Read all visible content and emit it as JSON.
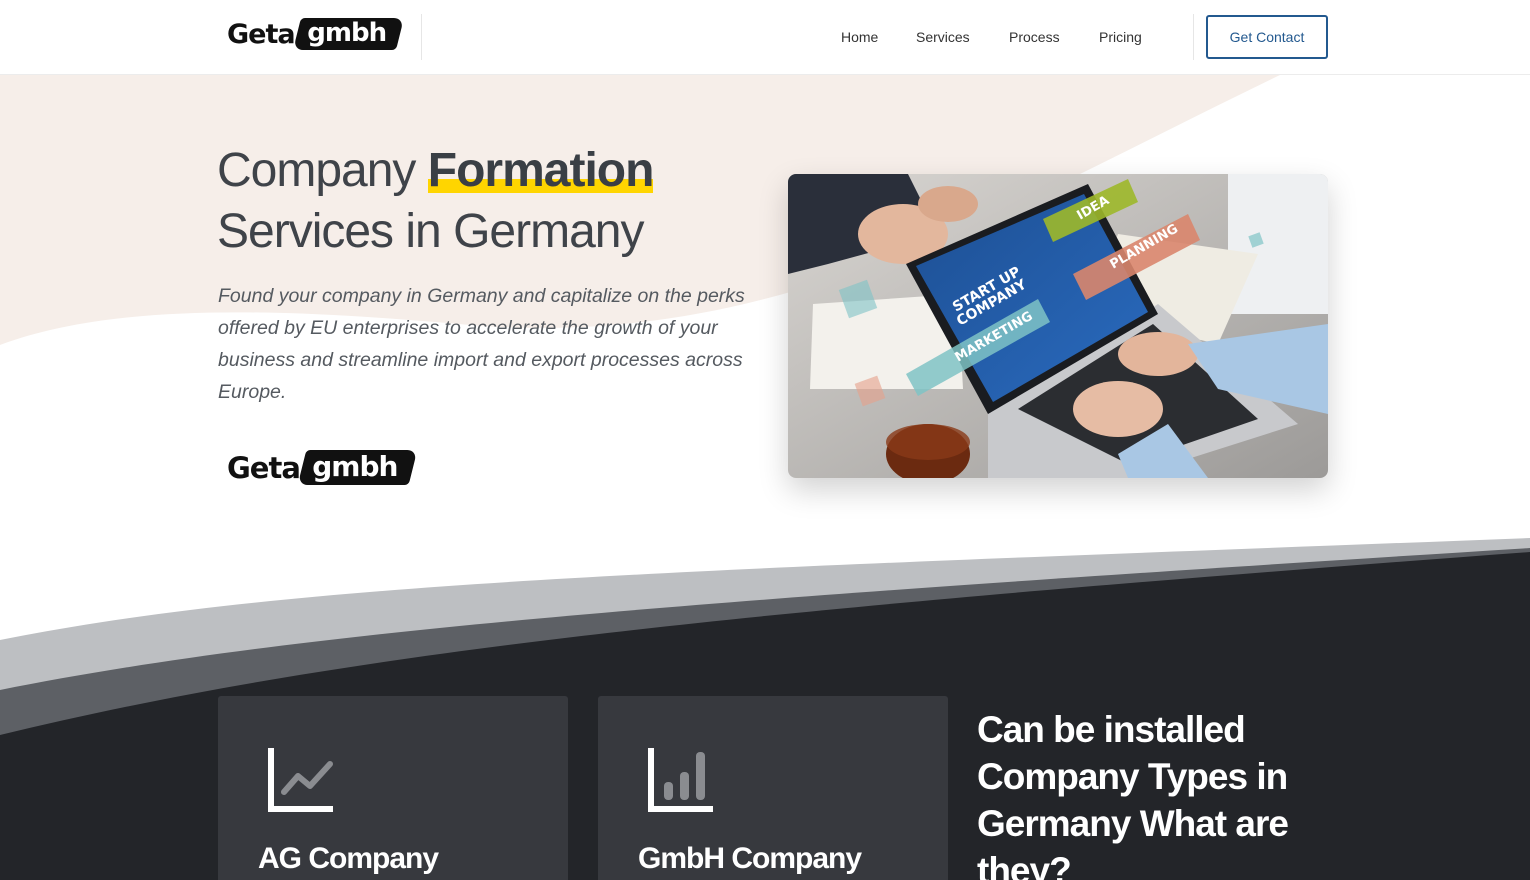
{
  "header": {
    "logo": {
      "text": "Geta",
      "badge": "gmbh"
    },
    "nav": [
      "Home",
      "Services",
      "Process",
      "Pricing"
    ],
    "cta_label": "Get Contact"
  },
  "hero": {
    "title_prefix": "Company ",
    "title_highlight": "Formation",
    "title_line2": "Services in Germany",
    "description": "Found your company in Germany and capitalize on the perks offered by EU enterprises to accelerate the growth of your business and streamline import and export processes across Europe.",
    "logo": {
      "text": "Geta",
      "badge": "gmbh"
    },
    "image": {
      "screen_text_1": "START UP",
      "screen_text_2": "COMPANY",
      "tag_idea": "IDEA",
      "tag_planning": "PLANNING",
      "tag_marketing": "MARKETING"
    }
  },
  "company_types": {
    "cards": [
      {
        "title": "AG Company",
        "icon": "line-chart-icon"
      },
      {
        "title": "GmbH Company",
        "icon": "bar-chart-icon"
      }
    ],
    "heading": "Can be installed Company Types in Germany What are they?"
  },
  "colors": {
    "accent": "#23598f",
    "highlight": "#ffd500",
    "hero_bg": "#f6eee9",
    "dark_section": "#232529",
    "card_bg": "#37393e"
  }
}
